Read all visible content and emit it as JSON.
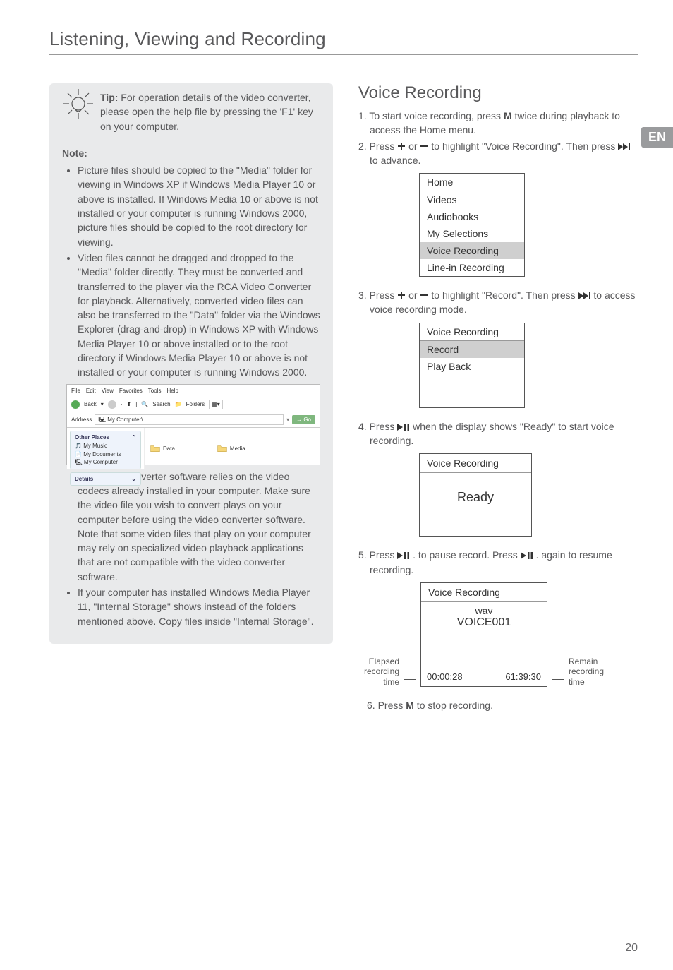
{
  "page_title": "Listening, Viewing and Recording",
  "en_tab": "EN",
  "page_number": "20",
  "tip": {
    "label": "Tip:",
    "text": "For operation details of the video converter, please open the help file by pressing the 'F1' key on your computer.",
    "note_label": "Note:",
    "bullets": [
      "Picture files should be copied to the \"Media\" folder for viewing in Windows XP if Windows Media Player 10 or above is installed. If Windows Media 10 or above is not installed or your computer is running Windows 2000, picture files should be copied to the root directory for viewing.",
      "Video files cannot be dragged and dropped to the \"Media\" folder directly. They must be converted and transferred to the player via the RCA Video Converter for playback. Alternatively, converted video files can also be transferred  to the \"Data\" folder via the Windows Explorer (drag-and-drop) in Windows XP with Windows Media Player 10 or above installed or to the root directory if Windows Media Player 10 or above is not installed or your computer is running Windows 2000."
    ],
    "after_shot": "This video converter software relies on the video codecs already installed in your computer.  Make sure the video file you wish to convert plays on your computer before using the video converter software.  Note that some video files that play on your computer may rely on specialized video playback applications that are not compatible with the video converter software.",
    "last_bullet": "If your computer has installed Windows Media Player 11, \"Internal Storage\" shows instead of the folders mentioned above. Copy files inside \"Internal Storage\"."
  },
  "explorer": {
    "menu": [
      "File",
      "Edit",
      "View",
      "Favorites",
      "Tools",
      "Help"
    ],
    "back": "Back",
    "search": "Search",
    "folders": "Folders",
    "address_label": "Address",
    "address_value": "My Computer\\",
    "go": "Go",
    "panel1_title": "Other Places",
    "panel1_items": [
      "My Music",
      "My Documents",
      "My Computer"
    ],
    "panel2_title": "Details",
    "folder1": "Data",
    "folder2": "Media"
  },
  "voice": {
    "title": "Voice Recording",
    "step1_a": "1. To start voice recording, press ",
    "step1_b": " twice during playback to access the Home menu.",
    "step2_a": "2. Press ",
    "step2_b": " or ",
    "step2_c": " to highlight \"Voice Recording\". Then press ",
    "step2_d": " to advance.",
    "menu1_title": "Home",
    "menu1_items": [
      "Videos",
      "Audiobooks",
      "My Selections",
      "Voice Recording",
      "Line-in Recording"
    ],
    "menu1_highlight_index": 3,
    "step3_a": "3. Press ",
    "step3_b": " or ",
    "step3_c": " to highlight \"Record\". Then press ",
    "step3_d": " to access voice recording mode.",
    "menu2_title": "Voice Recording",
    "menu2_items": [
      "Record",
      "Play Back"
    ],
    "menu2_highlight_index": 0,
    "step4_a": "4. Press ",
    "step4_b": " when the display shows \"Ready\" to start voice recording.",
    "ready_title": "Voice Recording",
    "ready_text": "Ready",
    "step5_a": "5. Press ",
    "step5_b": " . to pause record. Press ",
    "step5_c": " . again to resume recording.",
    "rec_title": "Voice Recording",
    "rec_line1": "wav",
    "rec_line2": "VOICE001",
    "rec_time_left": "00:00:28",
    "rec_time_right": "61:39:30",
    "label_left": "Elapsed recording time",
    "label_right": "Remain recording time",
    "step6_a": "6. Press ",
    "step6_b": " to stop recording.",
    "btn_m": "M",
    "btn_plus": "+",
    "btn_minus": "–"
  }
}
